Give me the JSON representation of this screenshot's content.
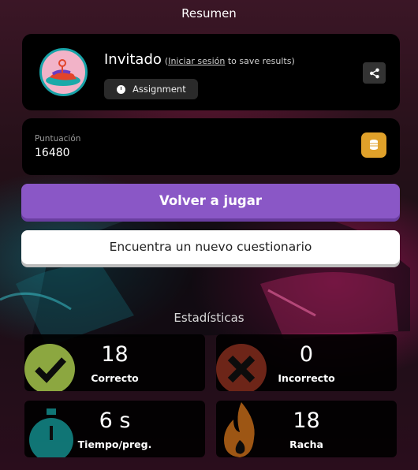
{
  "header": {
    "title": "Resumen"
  },
  "profile": {
    "name": "Invitado",
    "login_prefix": "(",
    "login_link": "Iniciar sesión",
    "login_suffix": " to save results)",
    "assignment_label": "Assignment",
    "share_icon": "share-icon"
  },
  "score": {
    "label": "Puntuación",
    "value": "16480",
    "icon": "coins-icon"
  },
  "actions": {
    "play_again": "Volver a jugar",
    "find_quiz": "Encuentra un nuevo cuestionario"
  },
  "stats": {
    "title": "Estadísticas",
    "items": [
      {
        "value": "18",
        "label": "Correcto",
        "icon": "checkmark-icon",
        "color": "#a4c44b"
      },
      {
        "value": "0",
        "label": "Incorrecto",
        "icon": "cross-icon",
        "color": "#c4442c"
      },
      {
        "value": "6 s",
        "label": "Tiempo/preg.",
        "icon": "stopwatch-icon",
        "color": "#17a6a6"
      },
      {
        "value": "18",
        "label": "Racha",
        "icon": "flame-icon",
        "color": "#e07a1c"
      }
    ]
  }
}
